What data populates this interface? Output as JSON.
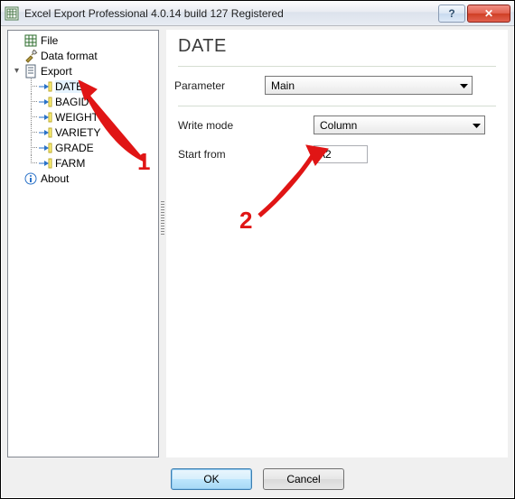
{
  "window": {
    "title": "Excel Export Professional 4.0.14 build 127 Registered",
    "help_symbol": "?",
    "close_symbol": "✕"
  },
  "tree": {
    "file": "File",
    "data_format": "Data format",
    "export": "Export",
    "children": {
      "date": "DATE",
      "bagid": "BAGID",
      "weight": "WEIGHT",
      "variety": "VARIETY",
      "grade": "GRADE",
      "farm": "FARM"
    },
    "about": "About"
  },
  "panel": {
    "heading": "DATE",
    "parameter_label": "Parameter",
    "parameter_value": "Main",
    "write_mode_label": "Write mode",
    "write_mode_value": "Column",
    "start_from_label": "Start from",
    "start_from_value": "A2"
  },
  "buttons": {
    "ok": "OK",
    "cancel": "Cancel"
  },
  "annotations": {
    "a1": "1",
    "a2": "2"
  }
}
